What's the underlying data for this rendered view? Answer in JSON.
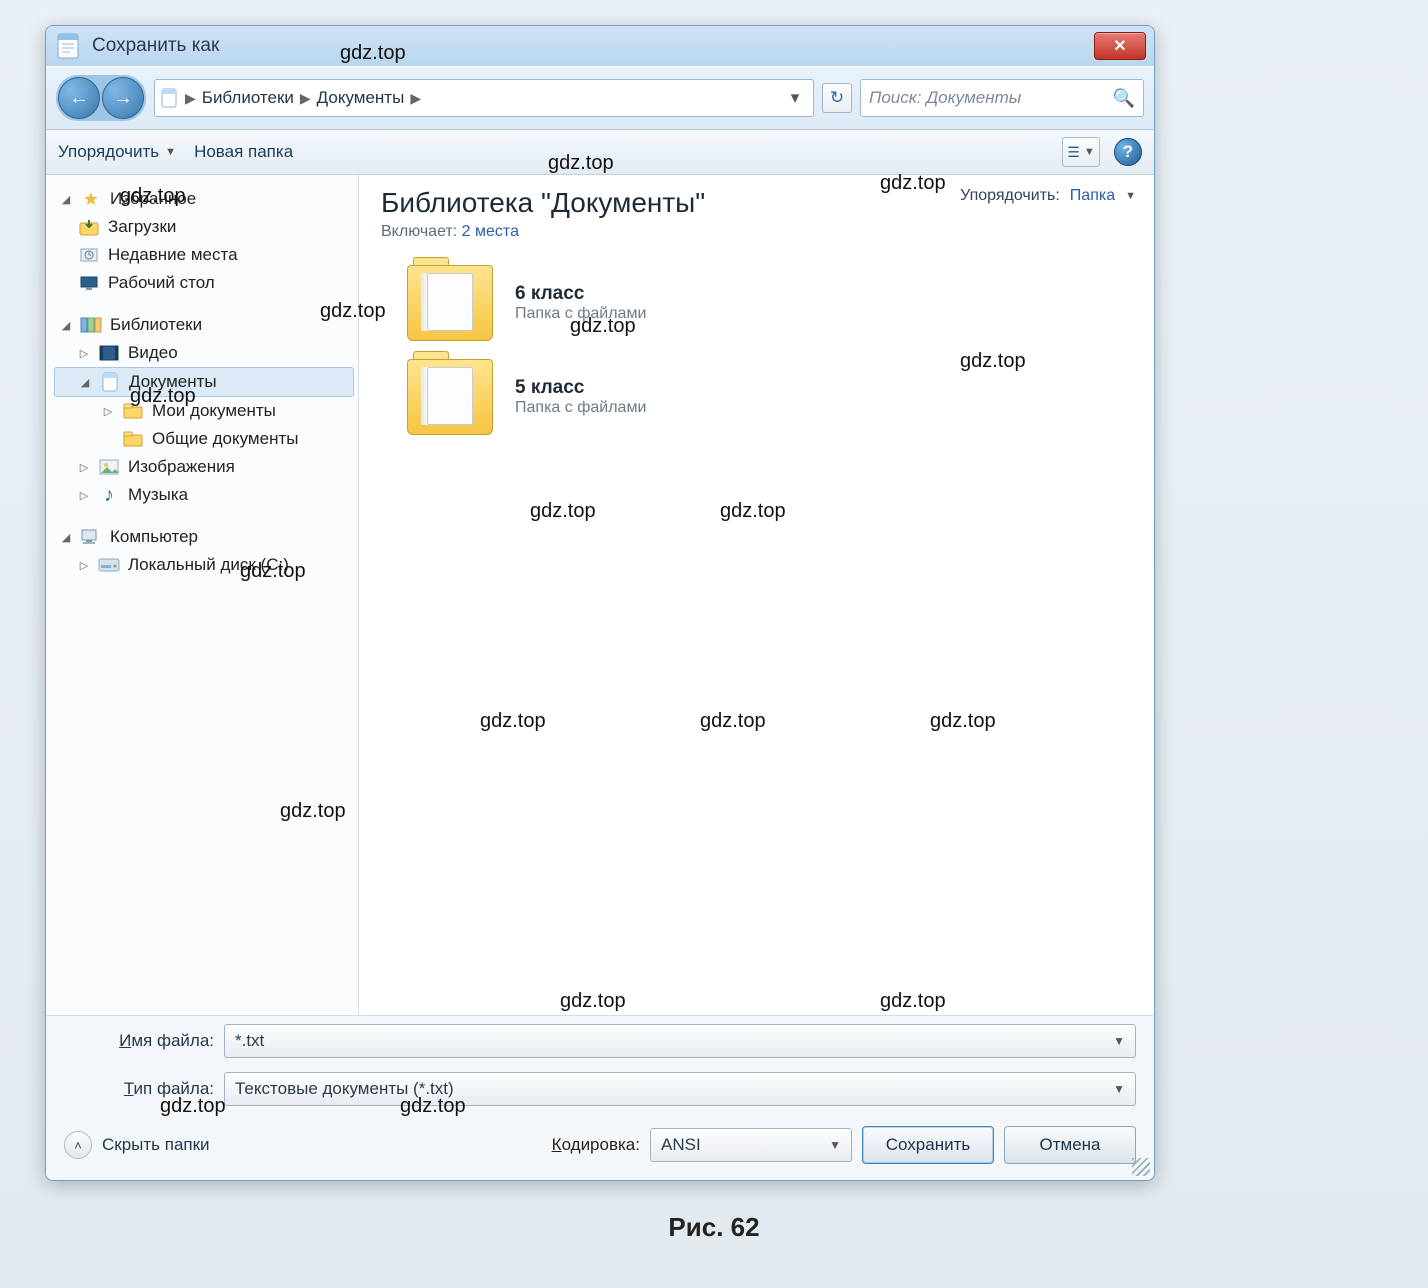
{
  "window": {
    "title": "Сохранить как"
  },
  "nav": {
    "crumbs": [
      "Библиотеки",
      "Документы"
    ],
    "refresh_icon": "refresh",
    "search_placeholder": "Поиск: Документы"
  },
  "toolbar": {
    "organize": "Упорядочить",
    "new_folder": "Новая папка"
  },
  "tree": {
    "favorites": {
      "label": "Избранное",
      "items": [
        {
          "label": "Загрузки",
          "icon": "downloads"
        },
        {
          "label": "Недавние места",
          "icon": "recent"
        },
        {
          "label": "Рабочий стол",
          "icon": "desktop"
        }
      ]
    },
    "libraries": {
      "label": "Библиотеки",
      "items": [
        {
          "label": "Видео",
          "icon": "video"
        },
        {
          "label": "Документы",
          "icon": "documents",
          "selected": true,
          "children": [
            {
              "label": "Мои документы",
              "icon": "folder"
            },
            {
              "label": "Общие документы",
              "icon": "folder"
            }
          ]
        },
        {
          "label": "Изображения",
          "icon": "pictures"
        },
        {
          "label": "Музыка",
          "icon": "music"
        }
      ]
    },
    "computer": {
      "label": "Компьютер",
      "items": [
        {
          "label": "Локальный диск (C:)",
          "icon": "drive"
        }
      ]
    }
  },
  "content": {
    "library_title": "Библиотека \"Документы\"",
    "includes_label": "Включает:",
    "includes_link": "2 места",
    "arrange_label": "Упорядочить:",
    "arrange_value": "Папка",
    "folders": [
      {
        "name": "6 класс",
        "desc": "Папка с файлами"
      },
      {
        "name": "5 класс",
        "desc": "Папка с файлами"
      }
    ]
  },
  "form": {
    "filename_label_pre": "",
    "filename_label_key": "И",
    "filename_label_rest": "мя файла:",
    "filename_value": "*.txt",
    "filetype_label_key": "Т",
    "filetype_label_rest": "ип файла:",
    "filetype_value": "Текстовые документы (*.txt)",
    "encoding_label_key": "К",
    "encoding_label_rest": "одировка:",
    "encoding_value": "ANSI",
    "hide_folders": "Скрыть папки",
    "save": "Сохранить",
    "cancel": "Отмена"
  },
  "caption": "Рис. 62",
  "watermark": "gdz.top"
}
